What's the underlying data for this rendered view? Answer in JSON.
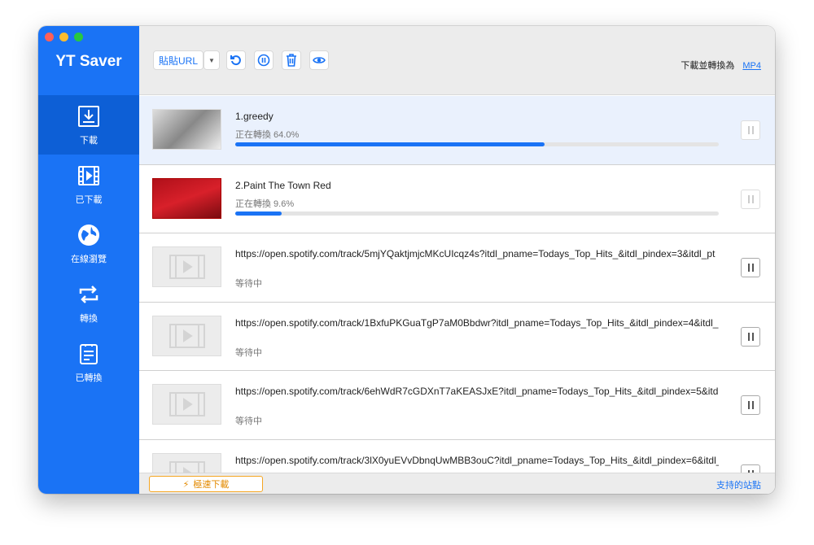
{
  "app": {
    "title": "YT Saver"
  },
  "colors": {
    "accent": "#1a73f5",
    "sidebar_active": "#0d5fd6",
    "fast": "#f5a623"
  },
  "sidebar": {
    "items": [
      {
        "label": "下載",
        "icon": "download-icon",
        "active": true
      },
      {
        "label": "已下載",
        "icon": "film-icon"
      },
      {
        "label": "在線瀏覽",
        "icon": "globe-icon"
      },
      {
        "label": "轉換",
        "icon": "convert-icon"
      },
      {
        "label": "已轉換",
        "icon": "clipboard-icon"
      }
    ]
  },
  "toolbar": {
    "paste_url": "貼貼URL",
    "format_label": "下載並轉換為",
    "format_value": "MP4"
  },
  "items": [
    {
      "title": "1.greedy",
      "status": "正在轉換 64.0%",
      "progress": 64.0,
      "selected": true
    },
    {
      "title": "2.Paint The Town Red",
      "status": "正在轉換 9.6%",
      "progress": 9.6
    },
    {
      "title": "https://open.spotify.com/track/5mjYQaktjmjcMKcUIcqz4s?itdl_pname=Todays_Top_Hits_&itdl_pindex=3&itdl_pt",
      "status": "等待中"
    },
    {
      "title": "https://open.spotify.com/track/1BxfuPKGuaTgP7aM0Bbdwr?itdl_pname=Todays_Top_Hits_&itdl_pindex=4&itdl_",
      "status": "等待中"
    },
    {
      "title": "https://open.spotify.com/track/6ehWdR7cGDXnT7aKEASJxE?itdl_pname=Todays_Top_Hits_&itdl_pindex=5&itdl_",
      "status": "等待中"
    },
    {
      "title": "https://open.spotify.com/track/3lX0yuEVvDbnqUwMBB3ouC?itdl_pname=Todays_Top_Hits_&itdl_pindex=6&itdl_",
      "status": ""
    }
  ],
  "bottom": {
    "fast_download": "極速下載",
    "supported_sites": "支持的站點"
  }
}
